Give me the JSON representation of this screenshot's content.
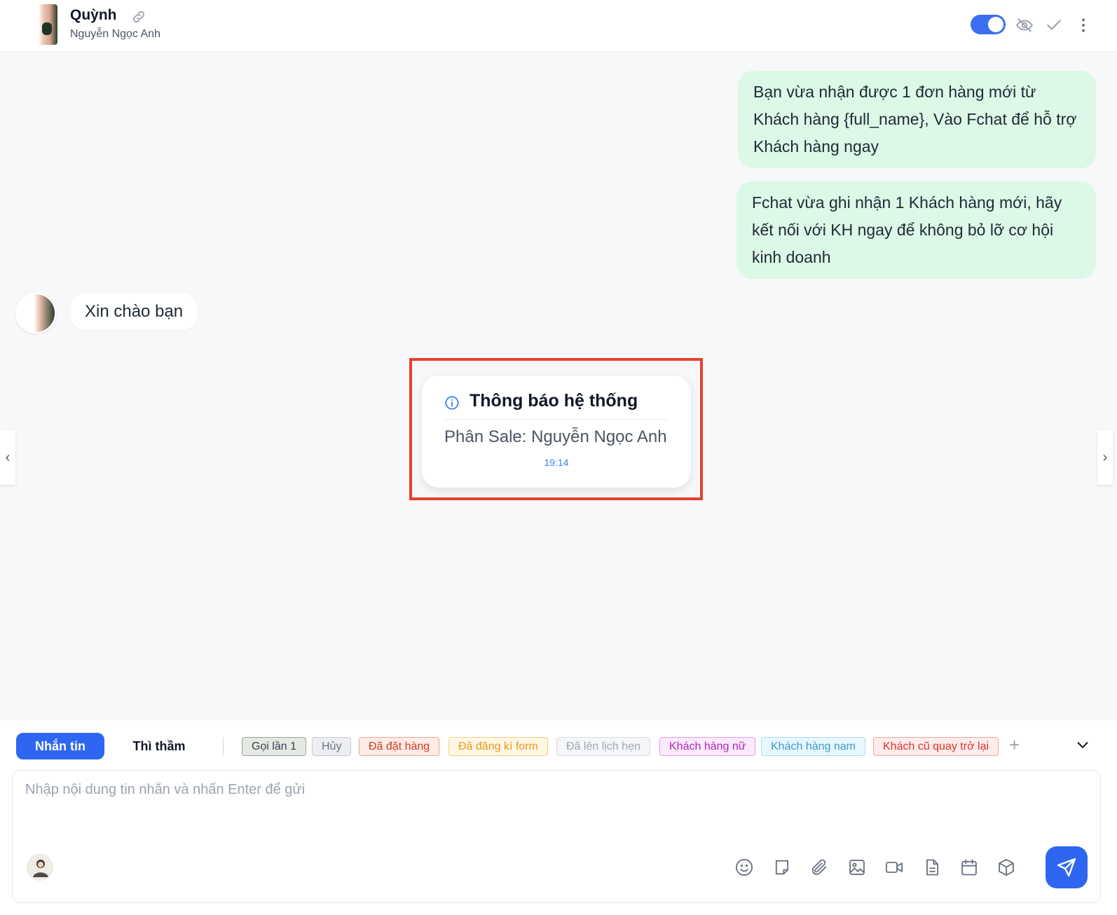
{
  "header": {
    "name": "Quỳnh",
    "subtitle": "Nguyễn Ngọc Anh",
    "toggle_on": true
  },
  "messages": {
    "outgoing": [
      "Bạn vừa nhận được 1 đơn hàng mới từ Khách hàng {full_name}, Vào Fchat để hỗ trợ Khách hàng ngay",
      "Fchat vừa ghi nhận 1 Khách hàng mới, hãy kết nối với KH ngay để không bỏ lỡ cơ hội kinh doanh"
    ],
    "incoming": "Xin chào bạn"
  },
  "system_notice": {
    "title": "Thông báo hệ thống",
    "body": "Phân Sale: Nguyễn Ngọc Anh",
    "time": "19:14"
  },
  "nav": {
    "prev": "‹",
    "next": "›"
  },
  "composer": {
    "tabs": [
      "Nhắn tin",
      "Thì thầm"
    ],
    "active_tab": "Nhắn tin",
    "tags": [
      {
        "label": "Gọi lần 1",
        "color": "#374151",
        "bg": "#e5e9e4",
        "border": "#9aa39a"
      },
      {
        "label": "Hủy",
        "color": "#6b7280",
        "bg": "#eceef2",
        "border": "#c5c9d1"
      },
      {
        "label": "Đã đặt hàng",
        "color": "#d23d1f",
        "bg": "#fdebe6",
        "border": "#f0a291"
      },
      {
        "label": "Đã đăng kí form",
        "color": "#e59b1a",
        "bg": "#fff6e4",
        "border": "#f6cf85"
      },
      {
        "label": "Đã lên lịch hẹn",
        "color": "#a0a7b5",
        "bg": "#f5f6fa",
        "border": "#d6dae3"
      },
      {
        "label": "Khách hàng nữ",
        "color": "#b028b8",
        "bg": "#fbe9fc",
        "border": "#e3a0e8"
      },
      {
        "label": "Khách hàng nam",
        "color": "#3f9cc9",
        "bg": "#e8f6fd",
        "border": "#a9dbf1"
      },
      {
        "label": "Khách cũ quay trở lại",
        "color": "#d8352e",
        "bg": "#fdeceb",
        "border": "#f1a39f"
      }
    ],
    "add_tag": "+",
    "input_value": "",
    "placeholder": "Nhập nội dung tin nhắn và nhấn Enter để gửi"
  },
  "icons": {
    "header": [
      "link-icon",
      "eye-off-icon",
      "check-icon",
      "more-vertical-icon"
    ],
    "toolbar": [
      "emoji-icon",
      "note-icon",
      "paperclip-icon",
      "image-icon",
      "video-icon",
      "document-icon",
      "calendar-icon",
      "box-icon",
      "send-icon"
    ]
  },
  "colors": {
    "accent": "#2f66f1",
    "outgoing_bubble": "#dcf8e6",
    "highlight": "#e6402c"
  }
}
